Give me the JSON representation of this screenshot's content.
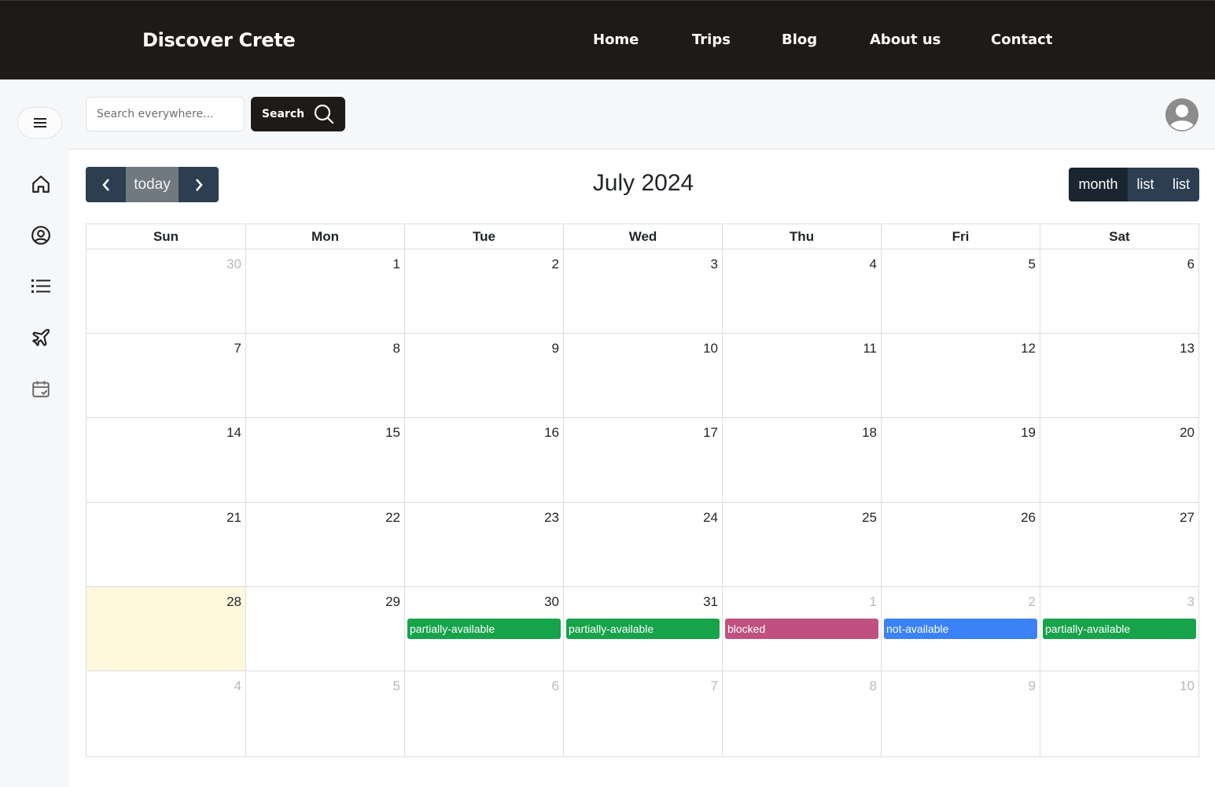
{
  "brand": "Discover Crete",
  "nav": [
    {
      "label": "Home",
      "name": "nav-home"
    },
    {
      "label": "Trips",
      "name": "nav-trips"
    },
    {
      "label": "Blog",
      "name": "nav-blog"
    },
    {
      "label": "About us",
      "name": "nav-about-us"
    },
    {
      "label": "Contact",
      "name": "nav-contact"
    }
  ],
  "sidebar": {
    "icons": [
      "home-icon",
      "user-circle-icon",
      "list-icon",
      "airplane-icon",
      "calendar-check-icon"
    ]
  },
  "search": {
    "placeholder": "Search everywhere...",
    "button_label": "Search"
  },
  "calendar": {
    "title": "July 2024",
    "today_label": "today",
    "views": [
      "month",
      "list",
      "list"
    ],
    "weekdays": [
      "Sun",
      "Mon",
      "Tue",
      "Wed",
      "Thu",
      "Fri",
      "Sat"
    ],
    "weeks": [
      [
        {
          "d": "30",
          "other": true
        },
        {
          "d": "1"
        },
        {
          "d": "2"
        },
        {
          "d": "3"
        },
        {
          "d": "4"
        },
        {
          "d": "5"
        },
        {
          "d": "6"
        }
      ],
      [
        {
          "d": "7"
        },
        {
          "d": "8"
        },
        {
          "d": "9"
        },
        {
          "d": "10"
        },
        {
          "d": "11"
        },
        {
          "d": "12"
        },
        {
          "d": "13"
        }
      ],
      [
        {
          "d": "14"
        },
        {
          "d": "15"
        },
        {
          "d": "16"
        },
        {
          "d": "17"
        },
        {
          "d": "18"
        },
        {
          "d": "19"
        },
        {
          "d": "20"
        }
      ],
      [
        {
          "d": "21"
        },
        {
          "d": "22"
        },
        {
          "d": "23"
        },
        {
          "d": "24"
        },
        {
          "d": "25"
        },
        {
          "d": "26"
        },
        {
          "d": "27"
        }
      ],
      [
        {
          "d": "28",
          "today": true
        },
        {
          "d": "29"
        },
        {
          "d": "30",
          "event": {
            "label": "partially-available",
            "color": "#16a34a"
          }
        },
        {
          "d": "31",
          "event": {
            "label": "partially-available",
            "color": "#16a34a"
          }
        },
        {
          "d": "1",
          "other": true,
          "event": {
            "label": "blocked",
            "color": "#c0507f"
          }
        },
        {
          "d": "2",
          "other": true,
          "event": {
            "label": "not-available",
            "color": "#3b82f6"
          }
        },
        {
          "d": "3",
          "other": true,
          "event": {
            "label": "partially-available",
            "color": "#16a34a"
          }
        }
      ],
      [
        {
          "d": "4",
          "other": true
        },
        {
          "d": "5",
          "other": true
        },
        {
          "d": "6",
          "other": true
        },
        {
          "d": "7",
          "other": true
        },
        {
          "d": "8",
          "other": true
        },
        {
          "d": "9",
          "other": true
        },
        {
          "d": "10",
          "other": true
        }
      ]
    ]
  }
}
